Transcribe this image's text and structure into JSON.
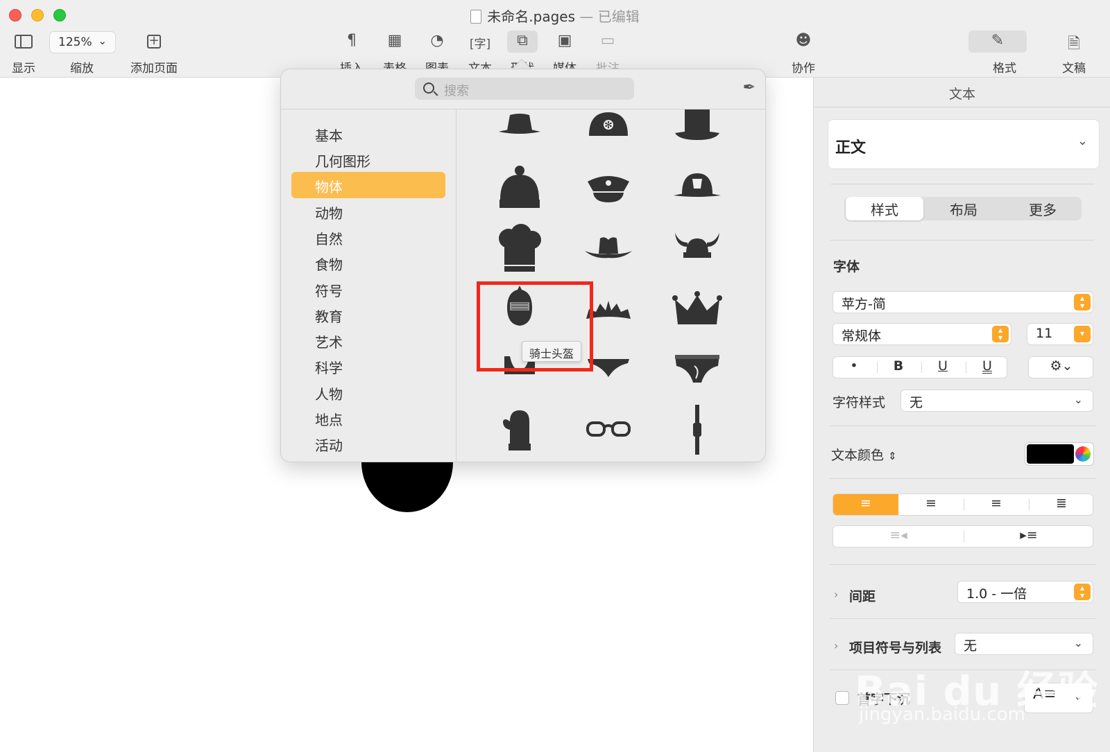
{
  "window": {
    "title": "未命名.pages",
    "separator": "—",
    "edited": "已编辑"
  },
  "toolbar": {
    "view_label": "显示",
    "zoom_value": "125%",
    "zoom_label": "缩放",
    "add_page_label": "添加页面",
    "insert_label": "插入",
    "table_label": "表格",
    "chart_label": "图表",
    "text_label": "文本",
    "shape_label": "形状",
    "media_label": "媒体",
    "comment_label": "批注",
    "collaborate_label": "协作",
    "format_label": "格式",
    "document_label": "文稿"
  },
  "shapes_popover": {
    "search_placeholder": "搜索",
    "categories": [
      "基本",
      "几何图形",
      "物体",
      "动物",
      "自然",
      "食物",
      "符号",
      "教育",
      "艺术",
      "科学",
      "人物",
      "地点",
      "活动"
    ],
    "selected_category": "物体",
    "tooltip": "骑士头盔",
    "highlight_color": "#f0281b",
    "selection_color": "#fcbd4f"
  },
  "inspector": {
    "tab_title": "文本",
    "paragraph_style": "正文",
    "segments": [
      "样式",
      "布局",
      "更多"
    ],
    "font_section": "字体",
    "font_family": "苹方-简",
    "font_weight": "常规体",
    "font_size": "11",
    "bold": "B",
    "underline": "U",
    "double_underline": "U",
    "char_style_label": "字符样式",
    "char_style_value": "无",
    "text_color_label": "文本颜色",
    "spacing_label": "间距",
    "spacing_value": "1.0 - 一倍",
    "bullets_label": "项目符号与列表",
    "bullets_value": "无",
    "drop_cap_label": "首字下沉",
    "accent_color": "#fca82a"
  },
  "watermark": {
    "text": "Bai du 经验",
    "sub": "jingyan.baidu.com"
  }
}
